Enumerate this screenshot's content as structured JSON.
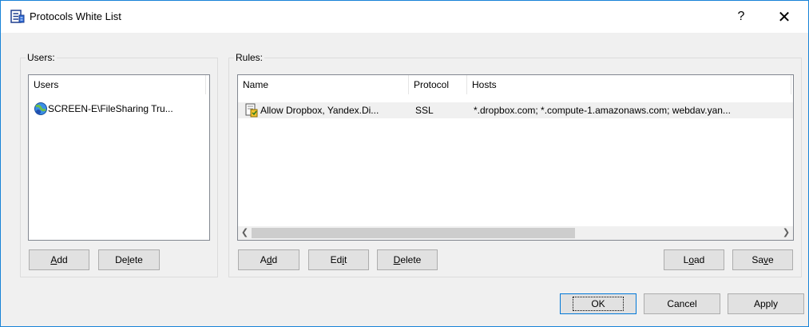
{
  "window": {
    "title": "Protocols White List",
    "help": "?",
    "close": "✕"
  },
  "users_group": {
    "legend": "Users:",
    "column": "Users",
    "items": [
      "SCREEN-E\\FileSharing Tru..."
    ],
    "add_pre": "",
    "add_key": "A",
    "add_post": "dd",
    "delete_pre": "De",
    "delete_key": "l",
    "delete_post": "ete"
  },
  "rules_group": {
    "legend": "Rules:",
    "columns": {
      "name": "Name",
      "protocol": "Protocol",
      "hosts": "Hosts"
    },
    "rows": [
      {
        "name": "Allow Dropbox, Yandex.Di...",
        "protocol": "SSL",
        "hosts": "*.dropbox.com; *.compute-1.amazonaws.com; webdav.yan..."
      }
    ],
    "add_pre": "A",
    "add_key": "d",
    "add_post": "d",
    "edit_pre": "Ed",
    "edit_key": "i",
    "edit_post": "t",
    "delete_pre": "",
    "delete_key": "D",
    "delete_post": "elete",
    "load_pre": "L",
    "load_key": "o",
    "load_post": "ad",
    "save_pre": "Sa",
    "save_key": "v",
    "save_post": "e"
  },
  "footer": {
    "ok": "OK",
    "cancel": "Cancel",
    "apply": "Apply"
  },
  "icons": {
    "title": "rules-list-icon",
    "user": "user-group-icon",
    "rule": "rule-document-icon"
  }
}
